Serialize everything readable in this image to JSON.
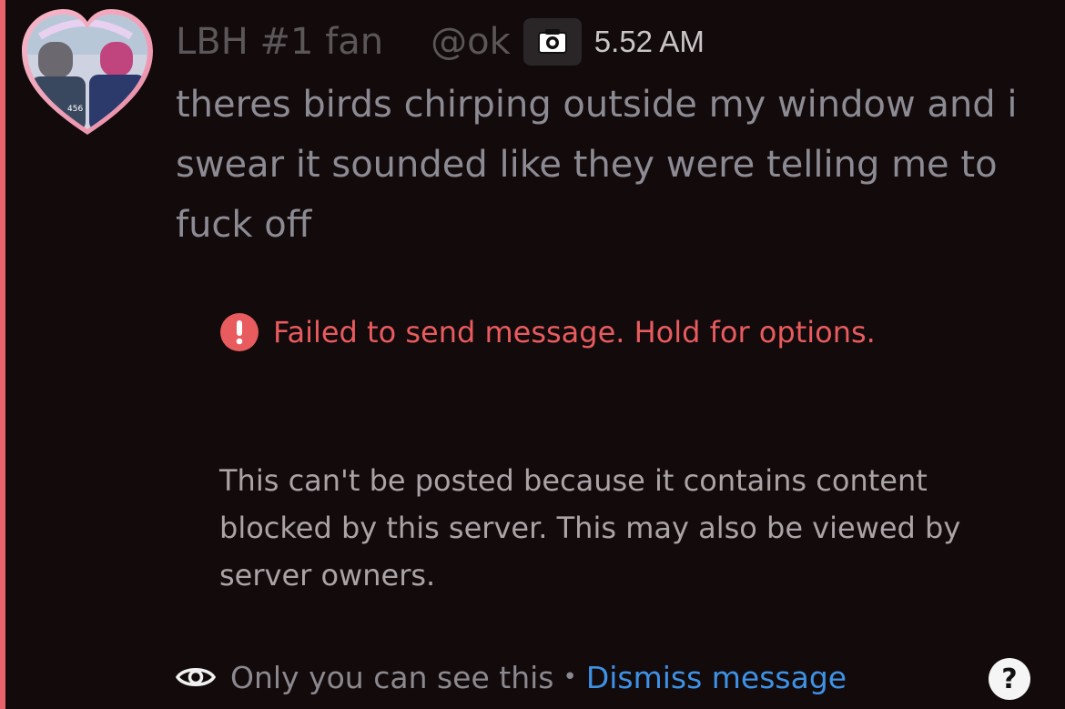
{
  "message": {
    "author": {
      "display_name": "LBH #1 fan",
      "handle": "@ok",
      "avatar_icon": "heart-photo-avatar",
      "server_tag_icon": "camera-icon"
    },
    "timestamp": "5.52 AM",
    "content": "theres birds chirping outside my window and i swear it sounded like they were telling me to fuck off"
  },
  "error": {
    "icon": "exclamation-circle-icon",
    "text": "Failed to send message. Hold for options."
  },
  "system_note": "This can't be posted because it contains content blocked by this server. This may also be viewed by server owners.",
  "footer": {
    "icon": "eye-icon",
    "visibility_text": "Only you can see this",
    "separator": "•",
    "dismiss_label": "Dismiss message",
    "help_label": "?"
  },
  "colors": {
    "background": "#120a0b",
    "accent_bar": "#e8636a",
    "error": "#e85b5e",
    "link": "#3e92e6"
  }
}
